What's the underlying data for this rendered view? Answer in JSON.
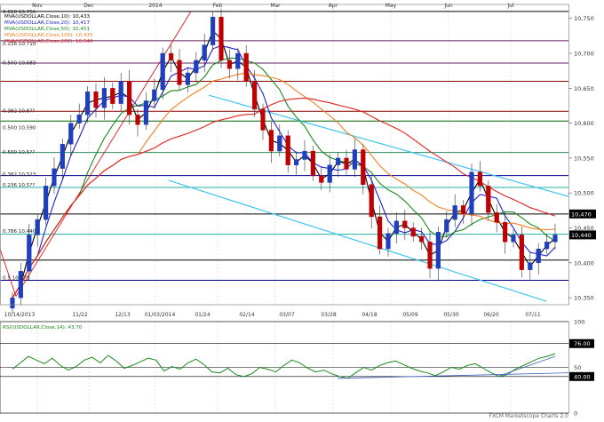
{
  "chart_data": {
    "type": "candlestick",
    "months": [
      "Nov",
      "Dec",
      "2014",
      "Feb",
      "Mar",
      "Apr",
      "May",
      "Jun",
      "Jul"
    ],
    "dates": [
      "10/14/2013",
      "11/22",
      "12/13",
      "01/03/2014",
      "01/24",
      "02/14",
      "03/07",
      "03/28",
      "04/18",
      "05/09",
      "05/30",
      "06/20",
      "07/11"
    ],
    "legend": [
      "MVA(USDOLLAR,Close,10): 10,433",
      "MVA(USDOLLAR,Close,20): 10,417",
      "MVA(USDOLLAR,Close,50): 10,451",
      "MVA(USDOLLAR,Close,100): 10,470",
      "MVA(USDOLLAR,Close,200): 10,540"
    ],
    "price_ticks": [
      "10,750",
      "10,700",
      "10,650",
      "10,600",
      "10,550",
      "10,500",
      "10,450",
      "10,400",
      "10,350"
    ],
    "price_range": [
      10340,
      10770
    ],
    "price_badges": [
      {
        "value": "10,470",
        "bg": "#000000",
        "fg": "#ffffff"
      },
      {
        "value": "10,440",
        "bg": "#000000",
        "fg": "#ffffff"
      }
    ],
    "fib_labels": [
      {
        "text": "0.618 10,756",
        "price": 10756
      },
      {
        "text": "0.236 10,710",
        "price": 10710
      },
      {
        "text": "0.500 10,683",
        "price": 10683
      },
      {
        "text": "0.382 10,6??",
        "price": 10614
      },
      {
        "text": "0.500 10,590",
        "price": 10590
      },
      {
        "text": "0.500 10,5??",
        "price": 10555
      },
      {
        "text": "0.382 10,523",
        "price": 10523
      },
      {
        "text": "0.236 10,5??",
        "price": 10508
      },
      {
        "text": "0.786 10,440",
        "price": 10442
      },
      {
        "text": "0.5 10,375",
        "price": 10375
      }
    ],
    "levels": [
      10760,
      10718,
      10686,
      10660,
      10617,
      10603,
      10558,
      10525,
      10508,
      10470,
      10441,
      10404,
      10375
    ],
    "closes": [
      10350,
      10388,
      10440,
      10462,
      10510,
      10535,
      10570,
      10600,
      10612,
      10645,
      10622,
      10650,
      10628,
      10660,
      10612,
      10598,
      10632,
      10648,
      10700,
      10690,
      10655,
      10672,
      10690,
      10712,
      10752,
      10690,
      10678,
      10700,
      10660,
      10620,
      10590,
      10560,
      10582,
      10540,
      10548,
      10560,
      10525,
      10515,
      10540,
      10550,
      10534,
      10562,
      10512,
      10466,
      10420,
      10442,
      10460,
      10450,
      10438,
      10430,
      10392,
      10444,
      10462,
      10482,
      10470,
      10530,
      10510,
      10472,
      10458,
      10430,
      10440,
      10390,
      10400,
      10420,
      10430,
      10440
    ],
    "rsi_ticks": [
      "100",
      "76.00",
      "50",
      "40.00",
      "0"
    ],
    "rsi_label": "RSI(USDOLLAR,Close,14): 43.70",
    "rsi_values": [
      48,
      55,
      62,
      58,
      54,
      60,
      52,
      47,
      51,
      58,
      61,
      55,
      63,
      57,
      49,
      52,
      56,
      60,
      58,
      46,
      51,
      48,
      55,
      59,
      53,
      45,
      44,
      49,
      42,
      40,
      43,
      50,
      48,
      45,
      52,
      58,
      55,
      49,
      45,
      47,
      43,
      40,
      38,
      44,
      50,
      47,
      52,
      55,
      57,
      53,
      49,
      46,
      44,
      41,
      45,
      50,
      48,
      52,
      54,
      49,
      44,
      40,
      42,
      48,
      52,
      56,
      60,
      62,
      65
    ],
    "footer": "FXCM Marketscope Charts 2.0"
  }
}
